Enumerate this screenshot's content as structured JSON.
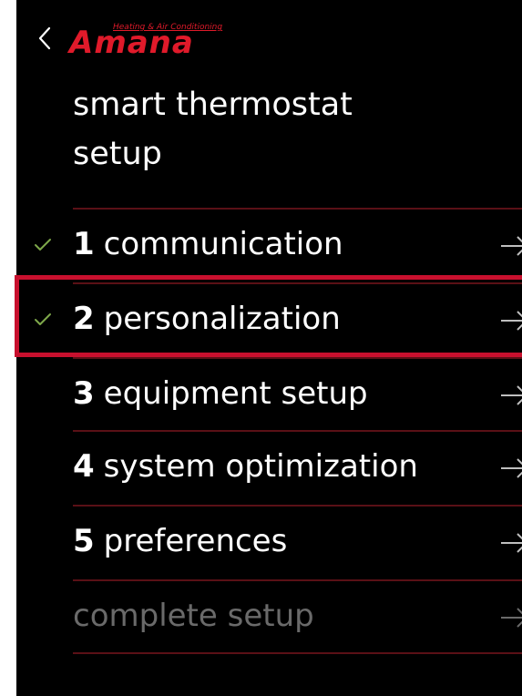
{
  "brand": {
    "name": "Amana",
    "tagline": "Heating & Air Conditioning",
    "color": "#e01a2a"
  },
  "header": {
    "back_icon": "chevron-left-icon",
    "title_line1": "smart thermostat",
    "title_line2": "setup"
  },
  "steps": [
    {
      "number": "1",
      "label": "communication",
      "completed": true,
      "enabled": true
    },
    {
      "number": "2",
      "label": "personalization",
      "completed": true,
      "enabled": true,
      "highlighted": true
    },
    {
      "number": "3",
      "label": "equipment setup",
      "completed": false,
      "enabled": true
    },
    {
      "number": "4",
      "label": "system optimization",
      "completed": false,
      "enabled": true
    },
    {
      "number": "5",
      "label": "preferences",
      "completed": false,
      "enabled": true
    },
    {
      "number": "",
      "label": "complete setup",
      "completed": false,
      "enabled": false
    }
  ],
  "colors": {
    "background": "#000000",
    "check": "#7ea84a",
    "divider": "#5a1016",
    "highlight": "#c8102e",
    "disabled_text": "#6a6a6a"
  }
}
